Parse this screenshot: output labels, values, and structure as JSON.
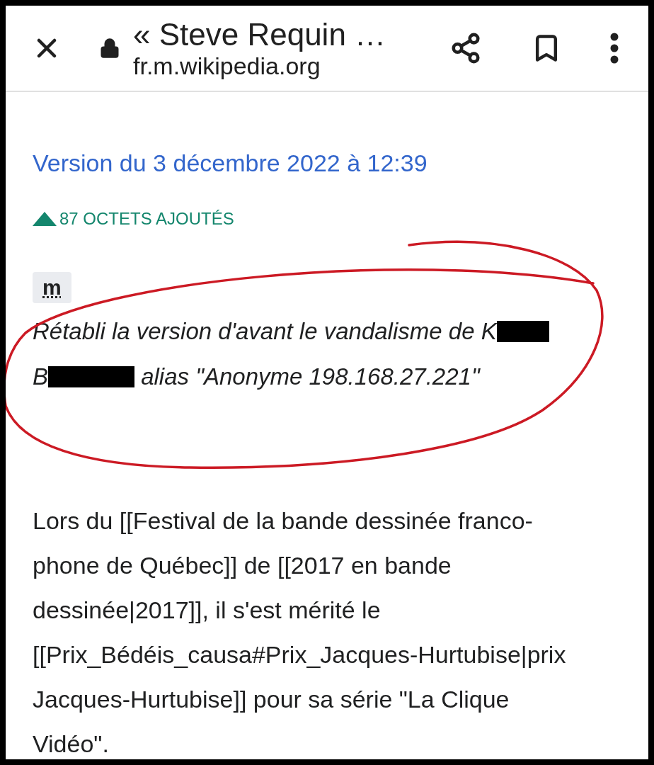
{
  "toolbar": {
    "title": "« Steve Requin …",
    "url": "fr.m.wikipedia.org"
  },
  "revision": {
    "link": "Version du 3 décembre 2022 à 12:39",
    "change": {
      "increase": true,
      "text": "87 OCTETS AJOUTÉS"
    },
    "minor_badge": "m",
    "summary_lines": [
      {
        "segments": [
          {
            "kind": "text",
            "text": "Rétabli la version d'avant le vandalisme de K"
          },
          {
            "kind": "short_redaction"
          }
        ]
      },
      {
        "segments": [
          {
            "kind": "text",
            "text": "B"
          },
          {
            "kind": "long_redaction"
          },
          {
            "kind": "text",
            "text": " alias \"Anonyme 198.168.27.221\""
          }
        ]
      }
    ]
  },
  "annotation": {
    "kind": "circle",
    "color": "#cc1a24"
  },
  "diff_text_lines": [
    "Lors du [[Festival de la bande dessinée franco-",
    "phone de Québec]] de [[2017 en bande",
    "dessinée|2017]], il s'est mérité le",
    "[[Prix_Bédéis_causa#Prix_Jacques-Hurtubise|prix",
    "Jacques-Hurtubise]] pour sa série \"La Clique",
    "Vidéo\"."
  ]
}
